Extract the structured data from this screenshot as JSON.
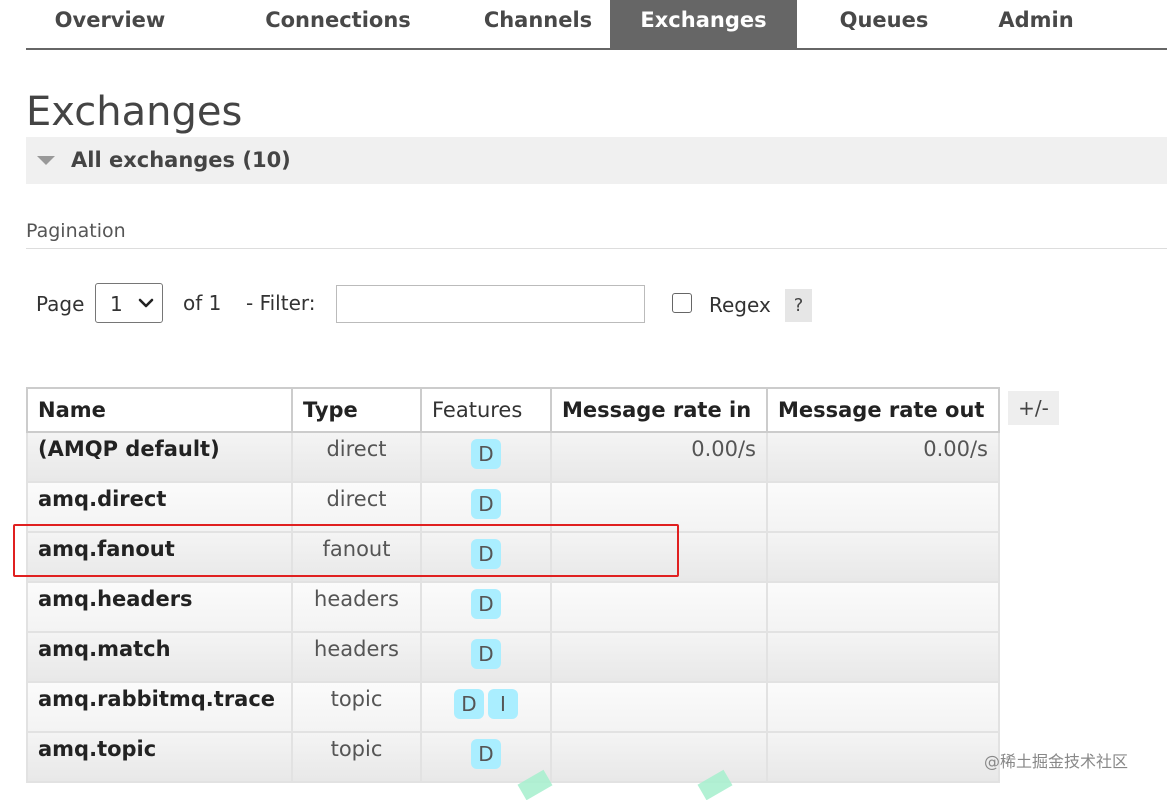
{
  "nav": {
    "tabs": [
      {
        "label": "Overview",
        "active": false
      },
      {
        "label": "Connections",
        "active": false
      },
      {
        "label": "Channels",
        "active": false
      },
      {
        "label": "Exchanges",
        "active": true
      },
      {
        "label": "Queues",
        "active": false
      },
      {
        "label": "Admin",
        "active": false
      }
    ]
  },
  "page": {
    "title": "Exchanges",
    "section_label": "All exchanges (10)"
  },
  "pagination": {
    "heading": "Pagination",
    "page_label": "Page",
    "page_value": "1",
    "of_label": "of 1",
    "filter_label": "- Filter:",
    "filter_value": "",
    "regex_label": "Regex",
    "regex_checked": false,
    "help_label": "?"
  },
  "table": {
    "columns": [
      "Name",
      "Type",
      "Features",
      "Message rate in",
      "Message rate out"
    ],
    "toggle_label": "+/-",
    "rows": [
      {
        "name": "(AMQP default)",
        "type": "direct",
        "features": [
          "D"
        ],
        "rate_in": "0.00/s",
        "rate_out": "0.00/s"
      },
      {
        "name": "amq.direct",
        "type": "direct",
        "features": [
          "D"
        ],
        "rate_in": "",
        "rate_out": ""
      },
      {
        "name": "amq.fanout",
        "type": "fanout",
        "features": [
          "D"
        ],
        "rate_in": "",
        "rate_out": ""
      },
      {
        "name": "amq.headers",
        "type": "headers",
        "features": [
          "D"
        ],
        "rate_in": "",
        "rate_out": ""
      },
      {
        "name": "amq.match",
        "type": "headers",
        "features": [
          "D"
        ],
        "rate_in": "",
        "rate_out": ""
      },
      {
        "name": "amq.rabbitmq.trace",
        "type": "topic",
        "features": [
          "D",
          "I"
        ],
        "rate_in": "",
        "rate_out": ""
      },
      {
        "name": "amq.topic",
        "type": "topic",
        "features": [
          "D"
        ],
        "rate_in": "",
        "rate_out": ""
      }
    ],
    "highlighted_row": "amq.fanout"
  },
  "watermark": "@稀土掘金技术社区",
  "colors": {
    "nav_active_bg": "#666666",
    "badge_bg": "#aaeeff",
    "highlight": "#e02020"
  }
}
